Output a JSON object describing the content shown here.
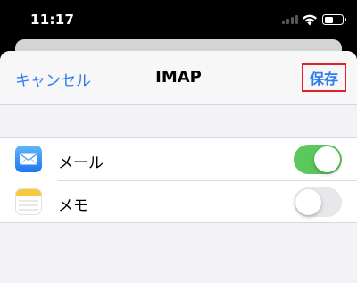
{
  "status_bar": {
    "time": "11:17"
  },
  "nav": {
    "cancel_label": "キャンセル",
    "title": "IMAP",
    "save_label": "保存",
    "highlight_color": "#e0202c",
    "accent_color": "#2f7bf0"
  },
  "rows": [
    {
      "label": "メール",
      "icon": "mail-icon",
      "enabled": true
    },
    {
      "label": "メモ",
      "icon": "notes-icon",
      "enabled": false
    }
  ],
  "colors": {
    "toggle_on": "#5ac85a",
    "toggle_off": "#e8e8ea"
  }
}
